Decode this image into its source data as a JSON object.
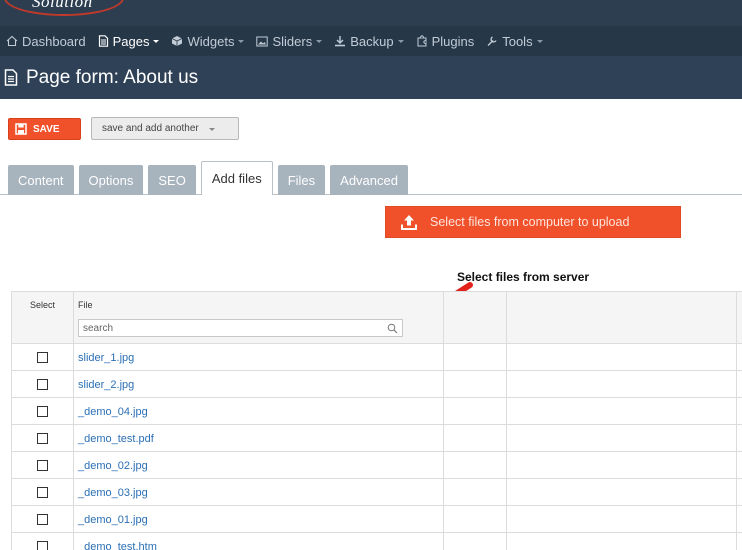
{
  "brand": {
    "logo_text": "Solution"
  },
  "nav": [
    {
      "label": "Dashboard",
      "icon": "home-icon",
      "caret": false,
      "active": false
    },
    {
      "label": "Pages",
      "icon": "page-icon",
      "caret": true,
      "active": true
    },
    {
      "label": "Widgets",
      "icon": "cube-icon",
      "caret": true,
      "active": false
    },
    {
      "label": "Sliders",
      "icon": "image-icon",
      "caret": true,
      "active": false
    },
    {
      "label": "Backup",
      "icon": "download-icon",
      "caret": true,
      "active": false
    },
    {
      "label": "Plugins",
      "icon": "puzzle-icon",
      "caret": false,
      "active": false
    },
    {
      "label": "Tools",
      "icon": "wrench-icon",
      "caret": true,
      "active": false
    }
  ],
  "page": {
    "title": "Page form: About us"
  },
  "toolbar": {
    "save_label": "SAVE",
    "save_another_label": "save and add another"
  },
  "tabs": [
    {
      "label": "Content",
      "active": false
    },
    {
      "label": "Options",
      "active": false
    },
    {
      "label": "SEO",
      "active": false
    },
    {
      "label": "Add files",
      "active": true
    },
    {
      "label": "Files",
      "active": false
    },
    {
      "label": "Advanced",
      "active": false
    }
  ],
  "upload": {
    "label": "Select files from computer to upload"
  },
  "server": {
    "label": "Select files from server"
  },
  "table": {
    "col_select": "Select",
    "col_file": "File",
    "search_placeholder": "search",
    "rows": [
      {
        "file": "slider_1.jpg"
      },
      {
        "file": "slider_2.jpg"
      },
      {
        "file": "_demo_04.jpg"
      },
      {
        "file": "_demo_test.pdf"
      },
      {
        "file": "_demo_02.jpg"
      },
      {
        "file": "_demo_03.jpg"
      },
      {
        "file": "_demo_01.jpg"
      },
      {
        "file": "_demo_test.htm"
      }
    ]
  },
  "colors": {
    "nav_bg": "#263748",
    "header_bg": "#2e4156",
    "accent_orange": "#f0512b",
    "tab_inactive": "#a7b3bd",
    "link": "#2a6fb5",
    "arrow_red": "#e3221c"
  }
}
